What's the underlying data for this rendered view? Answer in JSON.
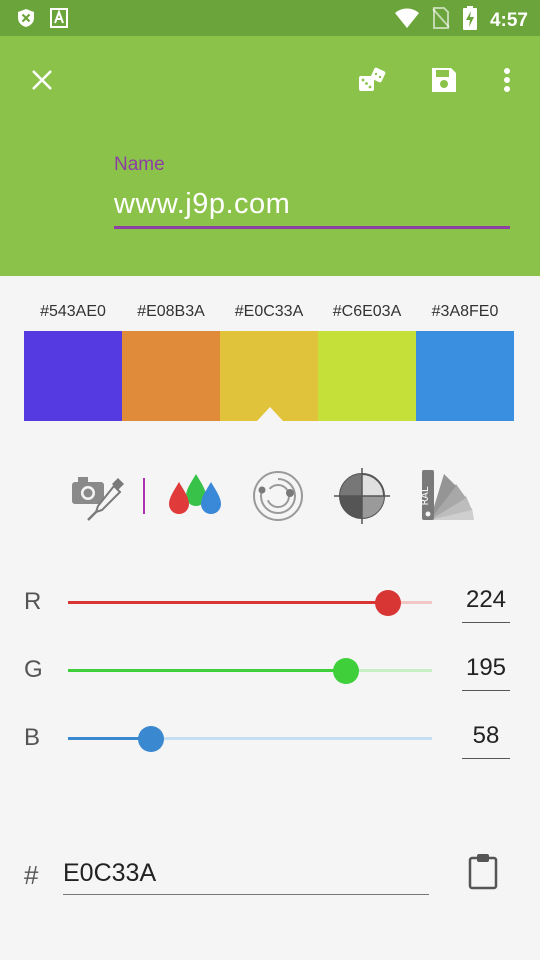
{
  "status_bar": {
    "time": "4:57"
  },
  "toolbar": {
    "name_label": "Name",
    "name_value": "www.j9p.com"
  },
  "palette": [
    {
      "hex": "#543AE0",
      "color": "#543ae0"
    },
    {
      "hex": "#E08B3A",
      "color": "#e08b3a"
    },
    {
      "hex": "#E0C33A",
      "color": "#e0c33a"
    },
    {
      "hex": "#C6E03A",
      "color": "#c6e03a"
    },
    {
      "hex": "#3A8FE0",
      "color": "#3a8fe0"
    }
  ],
  "selected_index": 2,
  "modes": [
    "camera-picker",
    "rgb-mixer",
    "color-wheel",
    "grayscale",
    "ral-fan"
  ],
  "sliders": [
    {
      "label": "R",
      "value": "224",
      "max": 255,
      "color": "#d83535",
      "light": "#f3c6c6"
    },
    {
      "label": "G",
      "value": "195",
      "max": 255,
      "color": "#3fcf3a",
      "light": "#c7efc6"
    },
    {
      "label": "B",
      "value": "58",
      "max": 255,
      "color": "#3a88d0",
      "light": "#c4dff2"
    }
  ],
  "hex_field": {
    "prefix": "#",
    "value": "E0C33A"
  }
}
